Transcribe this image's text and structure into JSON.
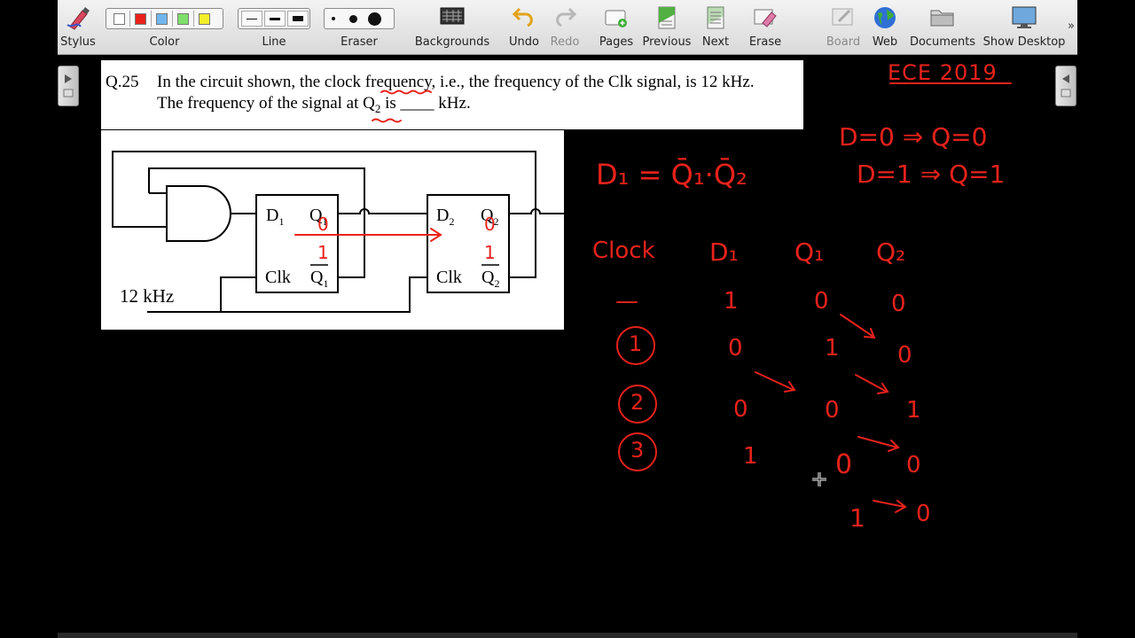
{
  "toolbar": {
    "stylus": "Stylus",
    "color": "Color",
    "line": "Line",
    "eraser": "Eraser",
    "backgrounds": "Backgrounds",
    "undo": "Undo",
    "redo": "Redo",
    "pages": "Pages",
    "previous": "Previous",
    "next": "Next",
    "erase": "Erase",
    "board": "Board",
    "web": "Web",
    "documents": "Documents",
    "show_desktop": "Show Desktop",
    "overflow": "»",
    "colors": [
      "#ffffff",
      "#e8221b",
      "#6fb7ee",
      "#7ee06a",
      "#f2ee2a"
    ]
  },
  "question": {
    "number": "Q.25",
    "line1": "In the circuit shown, the clock frequency, i.e., the frequency of the Clk signal, is 12 kHz.",
    "line2_a": "The frequency of the signal at",
    "line2_q": "Q",
    "line2_sub": "2",
    "line2_b": "is ____ kHz."
  },
  "circuit": {
    "ff1_d": "D",
    "ff1_d_sub": "1",
    "ff1_q": "Q",
    "ff1_q_sub": "1",
    "ff1_clk": "Clk",
    "ff1_qbar": "Q",
    "ff1_qbar_sub": "1",
    "ff2_d": "D",
    "ff2_d_sub": "2",
    "ff2_q": "Q",
    "ff2_q_sub": "2",
    "ff2_clk": "Clk",
    "ff2_qbar": "Q",
    "ff2_qbar_sub": "2",
    "clock_label": "12 kHz"
  },
  "annotations": {
    "title": "ECE 2019",
    "rule1": "D=0 ⇒ Q=0",
    "rule2": "D=1 ⇒ Q=1",
    "equation": "D₁ = Q̄₁·Q̄₂",
    "ff1_q_mark": "0",
    "ff1_qbar_mark": "1",
    "ff2_q_mark": "0",
    "ff2_qbar_mark": "1",
    "table_headers": [
      "Clock",
      "D₁",
      "Q₁",
      "Q₂"
    ],
    "table_rows": [
      {
        "clock": "—",
        "d1": "1",
        "q1": "0",
        "q2": "0"
      },
      {
        "clock": "1",
        "d1": "0",
        "q1": "1",
        "q2": "0"
      },
      {
        "clock": "2",
        "d1": "0",
        "q1": "0",
        "q2": "1"
      },
      {
        "clock": "3",
        "d1": "1",
        "q1": "0",
        "q2": "0"
      }
    ],
    "extra_q1": "1",
    "extra_q2": "0",
    "ink_color": "#e8221b"
  }
}
